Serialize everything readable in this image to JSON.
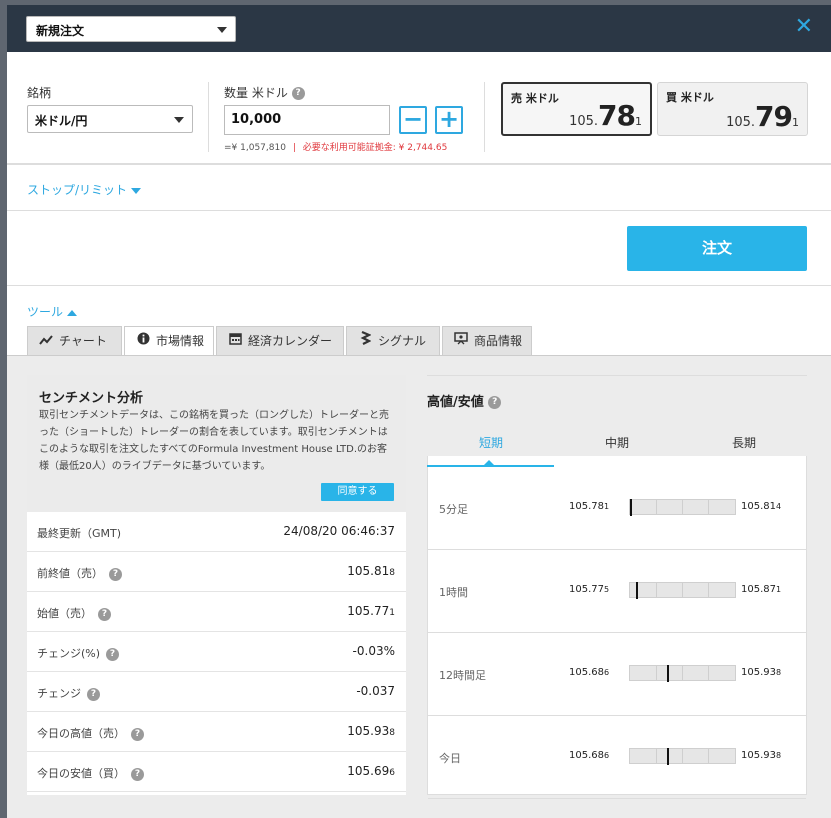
{
  "header": {
    "order_type": "新規注文",
    "close": "✕"
  },
  "symbol": {
    "label": "銘柄",
    "value": "米ドル/円"
  },
  "quantity": {
    "label": "数量 米ドル",
    "value": "10,000",
    "equiv": "=¥ 1,057,810",
    "separator": "|",
    "margin": "必要な利用可能証拠金: ¥ 2,744.65",
    "minus": "−",
    "plus": "+"
  },
  "sell": {
    "label": "売 米ドル",
    "big_a": "105.",
    "big_b": "78",
    "big_c": "1"
  },
  "buy": {
    "label": "買 米ドル",
    "big_a": "105.",
    "big_b": "79",
    "big_c": "1"
  },
  "stop_limit": "ストップ/リミット",
  "order_button": "注文",
  "tools": "ツール",
  "tabs": [
    {
      "label": "チャート",
      "icon": "chart-line-icon"
    },
    {
      "label": "市場情報",
      "icon": "info-icon"
    },
    {
      "label": "経済カレンダー",
      "icon": "calendar-icon"
    },
    {
      "label": "シグナル",
      "icon": "signal-icon"
    },
    {
      "label": "商品情報",
      "icon": "presentation-icon"
    }
  ],
  "sentiment": {
    "title": "センチメント分析",
    "text": "取引センチメントデータは、この銘柄を買った（ロングした）トレーダーと売った（ショートした）トレーダーの割合を表しています。取引センチメントはこのような取引を注文したすべてのFormula Investment House LTD.のお客様（最低20人）のライブデータに基づいています。",
    "agree": "同意する"
  },
  "market_rows": [
    {
      "label": "最終更新（GMT)",
      "value": "24/08/20 06:46:37",
      "small": "",
      "help": false
    },
    {
      "label": "前終値（売）",
      "value": "105.81",
      "small": "8",
      "help": true
    },
    {
      "label": "始値（売）",
      "value": "105.77",
      "small": "1",
      "help": true
    },
    {
      "label": "チェンジ(%)",
      "value": "-0.03%",
      "small": "",
      "help": true
    },
    {
      "label": "チェンジ",
      "value": "-0.037",
      "small": "",
      "help": true
    },
    {
      "label": "今日の高値（売）",
      "value": "105.93",
      "small": "8",
      "help": true
    },
    {
      "label": "今日の安値（買）",
      "value": "105.69",
      "small": "6",
      "help": true
    }
  ],
  "highlow": {
    "title": "高値/安値",
    "tabs": [
      "短期",
      "中期",
      "長期"
    ],
    "rows": [
      {
        "label": "5分足",
        "low": "105.78",
        "low_s": "1",
        "high": "105.81",
        "high_s": "4",
        "pos": 0.0
      },
      {
        "label": "1時間",
        "low": "105.77",
        "low_s": "5",
        "high": "105.87",
        "high_s": "1",
        "pos": 0.06
      },
      {
        "label": "12時間足",
        "low": "105.68",
        "low_s": "6",
        "high": "105.93",
        "high_s": "8",
        "pos": 0.36
      },
      {
        "label": "今日",
        "low": "105.68",
        "low_s": "6",
        "high": "105.93",
        "high_s": "8",
        "pos": 0.36
      }
    ]
  },
  "colors": {
    "accent": "#29b4e8",
    "header": "#2b3745",
    "warn": "#e0393e"
  }
}
